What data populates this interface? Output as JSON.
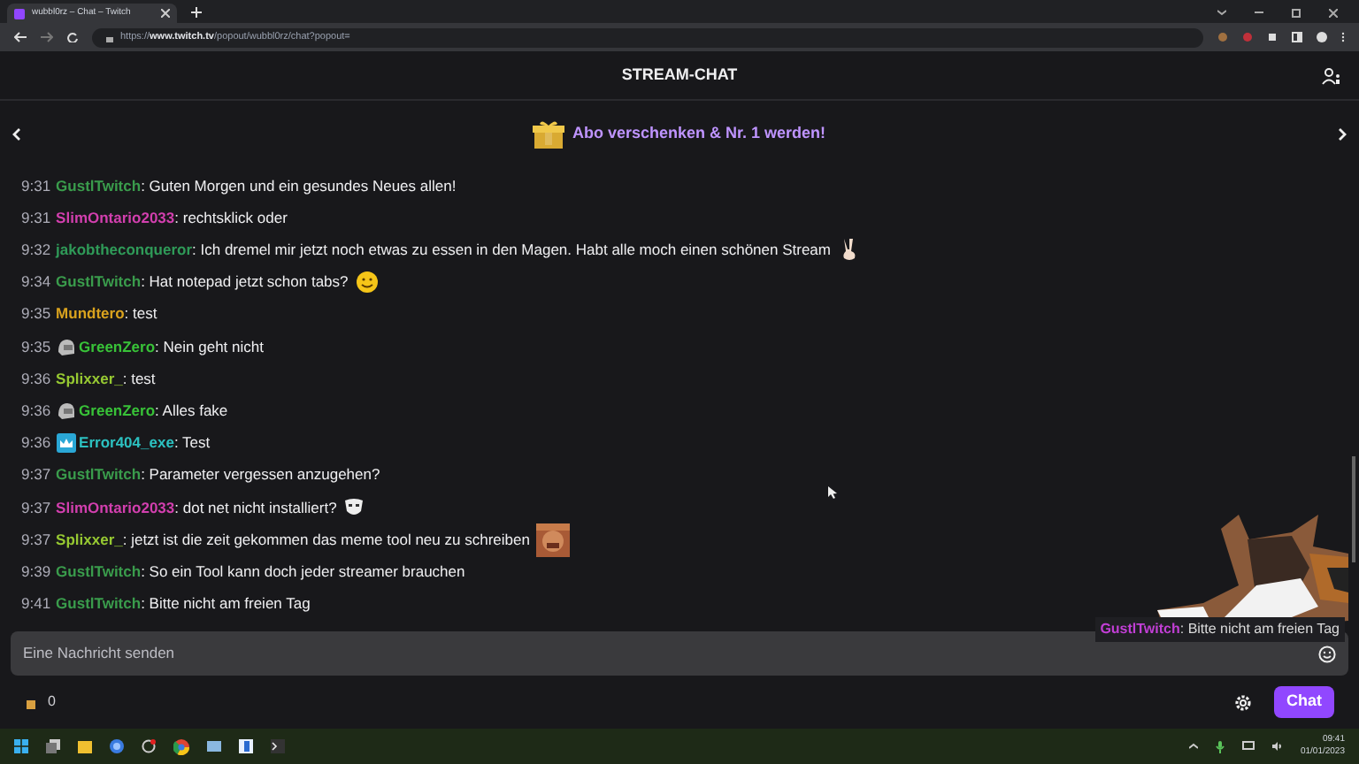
{
  "browser": {
    "tab_title": "wubbl0rz – Chat – Twitch",
    "url": "https://**www.twitch.tv**/popout/wubbl0rz/chat?popout="
  },
  "header": {
    "title": "STREAM-CHAT"
  },
  "banner": {
    "text": "Abo verschenken & Nr. 1 werden!"
  },
  "messages": [
    {
      "time": "9:31",
      "user": "GustlTwitch",
      "color": "#3a9c4c",
      "text": ": Guten Morgen und ein gesundes Neues allen!"
    },
    {
      "time": "9:31",
      "user": "SlimOntario2033",
      "color": "#d23fae",
      "text": ": rechtsklick oder"
    },
    {
      "time": "9:32",
      "user": "jakobtheconqueror",
      "color": "#2f9a58",
      "text": ": Ich dremel mir jetzt noch etwas zu essen in den Magen. Habt alle moch einen schönen Stream",
      "emote": {
        "kind": "peace"
      }
    },
    {
      "time": "9:34",
      "user": "GustlTwitch",
      "color": "#3a9c4c",
      "text": ": Hat notepad jetzt schon tabs?",
      "emote": {
        "kind": "smiley"
      }
    },
    {
      "time": "9:35",
      "user": "Mundtero",
      "color": "#d9a21e",
      "text": ": test"
    },
    {
      "time": "9:35",
      "badge": {
        "kind": "helmet"
      },
      "user": "GreenZero",
      "color": "#38c238",
      "text": ": Nein geht nicht"
    },
    {
      "time": "9:36",
      "user": "Splixxer_",
      "color": "#96c832",
      "text": ": test"
    },
    {
      "time": "9:36",
      "badge": {
        "kind": "helmet"
      },
      "user": "GreenZero",
      "color": "#38c238",
      "text": ": Alles fake"
    },
    {
      "time": "9:36",
      "badge": {
        "kind": "crown"
      },
      "user": "Error404_exe",
      "color": "#2cc0c0",
      "text": ": Test"
    },
    {
      "time": "9:37",
      "user": "GustlTwitch",
      "color": "#3a9c4c",
      "text": ": Parameter vergessen anzugehen?"
    },
    {
      "time": "9:37",
      "user": "SlimOntario2033",
      "color": "#d23fae",
      "text": ": dot net nicht installiert?",
      "emote": {
        "kind": "mask"
      }
    },
    {
      "time": "9:37",
      "user": "Splixxer_",
      "color": "#96c832",
      "text": ": jetzt ist die zeit gekommen das meme tool neu zu schreiben"
    },
    {
      "time": "9:39",
      "user": "GustlTwitch",
      "color": "#3a9c4c",
      "text": ": So ein Tool kann doch jeder streamer brauchen"
    },
    {
      "time": "9:41",
      "user": "GustlTwitch",
      "color": "#3a9c4c",
      "text": ": Bitte nicht am freien Tag"
    }
  ],
  "overlay": {
    "user": "GustlTwitch",
    "color": "#c23fd6",
    "text": ": Bitte nicht am freien Tag"
  },
  "input": {
    "placeholder": "Eine Nachricht senden"
  },
  "points": "0",
  "chat_button": "Chat",
  "clock": {
    "time": "09:41",
    "date": "01/01/2023"
  }
}
